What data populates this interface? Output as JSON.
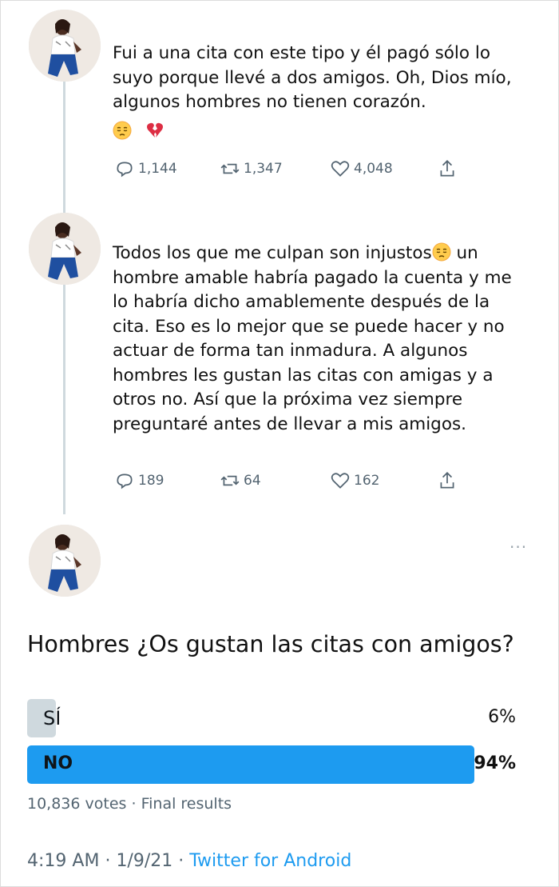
{
  "tweets": [
    {
      "text": "Fui a una cita con este tipo y él pagó sólo lo suyo porque llevé a dos amigos. Oh, Dios mío, algunos hombres no tienen corazón.",
      "emojis": [
        "pensive-face",
        "broken-heart"
      ],
      "replies": "1,144",
      "retweets": "1,347",
      "likes": "4,048"
    },
    {
      "text": "Todos los que me culpan son injustos",
      "text_rest": "un hombre amable habría pagado la cuenta y me lo habría dicho amablemente después de la cita. Eso es lo mejor que se puede hacer y no actuar de forma tan inmadura. A algunos hombres les gustan las citas con amigas y a otros no. Así que la próxima vez siempre preguntaré antes de llevar a mis amigos.",
      "emoji": "pensive-face",
      "replies": "189",
      "retweets": "64",
      "likes": "162"
    }
  ],
  "poll": {
    "question": "Hombres ¿Os gustan las citas con amigos?",
    "options": [
      {
        "label": "SÍ",
        "percent_text": "6%",
        "share": 0.06,
        "color": "#cfd9de",
        "winner": false
      },
      {
        "label": "NO",
        "percent_text": "94%",
        "share": 0.94,
        "color": "#1d9bf0",
        "winner": true
      }
    ],
    "votes": "10,836 votes",
    "status": "Final results"
  },
  "footer": {
    "time": "4:19 AM",
    "date": "1/9/21",
    "source": "Twitter for Android"
  },
  "more_menu": "···",
  "colors": {
    "accent": "#1d9bf0",
    "muted": "#536471",
    "thread": "#cfd9de"
  }
}
